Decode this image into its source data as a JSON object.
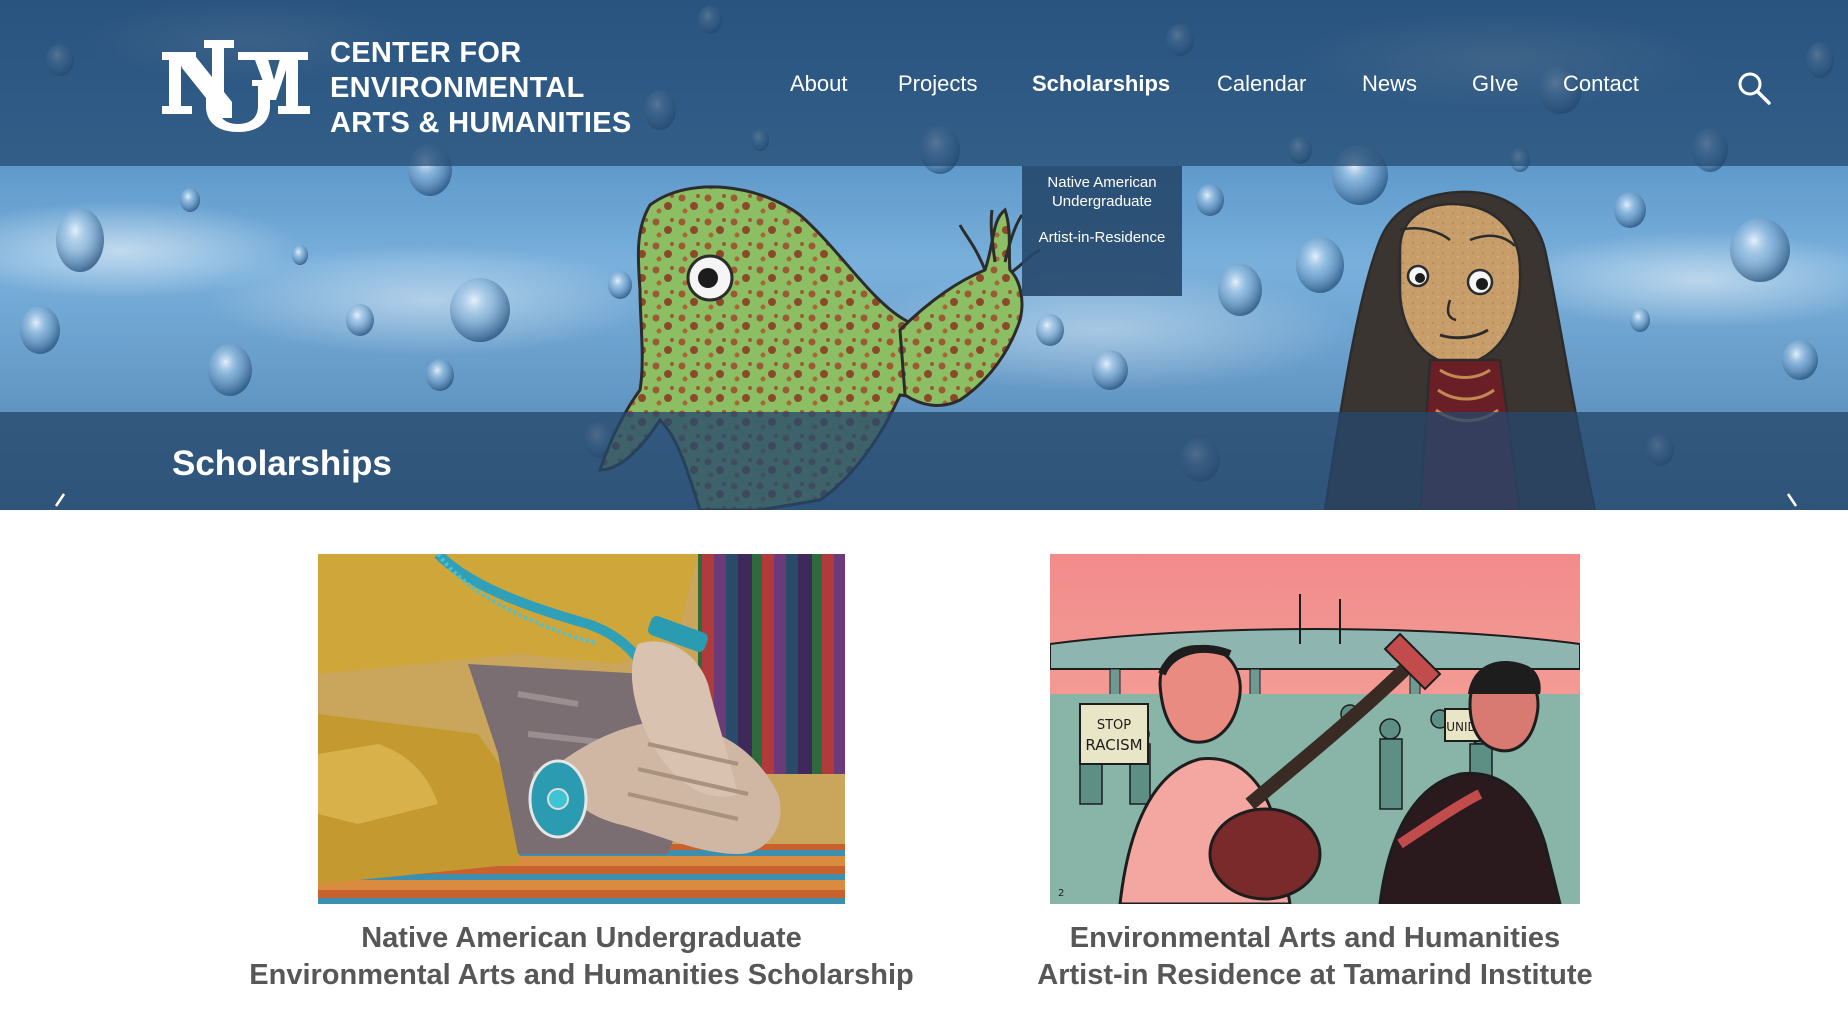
{
  "brand": {
    "name_lines": [
      "CENTER FOR",
      "ENVIRONMENTAL",
      "ARTS & HUMANITIES"
    ],
    "logo_icon": "unm-logo-icon"
  },
  "nav": {
    "items": [
      {
        "label": "About"
      },
      {
        "label": "Projects"
      },
      {
        "label": "Scholarships",
        "active": true
      },
      {
        "label": "Calendar"
      },
      {
        "label": "News"
      },
      {
        "label": "GIve"
      },
      {
        "label": "Contact"
      }
    ],
    "search_icon": "search-icon"
  },
  "dropdown": {
    "items": [
      {
        "label": "Native American Undergraduate"
      },
      {
        "label": "Artist-in-Residence"
      }
    ]
  },
  "hero": {
    "title": "Scholarships",
    "prev_icon": "chevron-left-icon",
    "next_icon": "chevron-right-icon"
  },
  "cards": [
    {
      "title_lines": [
        "Native American Undergraduate",
        "Environmental Arts and Humanities Scholarship"
      ],
      "image_icon": "hands-photo"
    },
    {
      "title_lines": [
        "Environmental Arts and Humanities",
        "Artist-in Residence at Tamarind Institute"
      ],
      "image_icon": "musicians-illustration"
    }
  ],
  "colors": {
    "header_overlay": "#21466e",
    "title_text": "#575757",
    "sky": "#5c97c9"
  }
}
